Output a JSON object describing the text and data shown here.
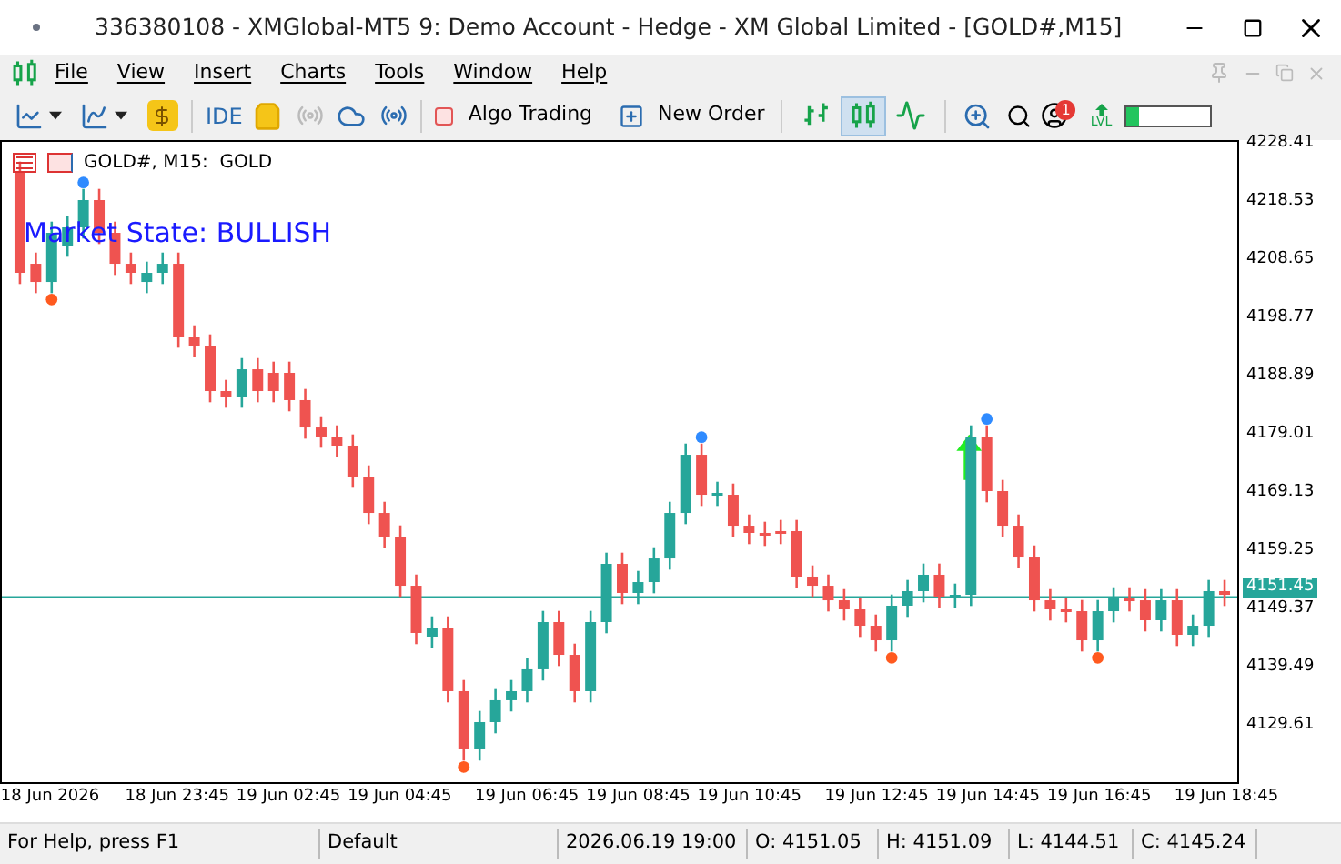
{
  "window": {
    "title": "336380108 - XMGlobal-MT5 9: Demo Account - Hedge - XM Global Limited - [GOLD#,M15]"
  },
  "menu": [
    "File",
    "View",
    "Insert",
    "Charts",
    "Tools",
    "Window",
    "Help"
  ],
  "toolbar": {
    "ide": "IDE",
    "algo_trading": "Algo Trading",
    "new_order": "New Order",
    "chart_types": [
      {
        "selected": false
      },
      {
        "selected": true
      },
      {
        "selected": false
      }
    ],
    "notifications": "1",
    "level_label": "LVL",
    "signal_meter": {
      "level": 0.15
    }
  },
  "chart": {
    "header": "GOLD#, M15:  GOLD",
    "market_state": "Market State: BULLISH",
    "chart_data": {
      "type": "candlestick",
      "ylim": [
        4120.04,
        4228.72
      ],
      "yticks": [
        {
          "value": 4228.41,
          "label": "4228.41"
        },
        {
          "value": 4218.53,
          "label": "4218.53"
        },
        {
          "value": 4208.65,
          "label": "4208.65"
        },
        {
          "value": 4198.77,
          "label": "4198.77"
        },
        {
          "value": 4188.89,
          "label": "4188.89"
        },
        {
          "value": 4179.01,
          "label": "4179.01"
        },
        {
          "value": 4169.13,
          "label": "4169.13"
        },
        {
          "value": 4159.25,
          "label": "4159.25"
        },
        {
          "value": 4149.37,
          "label": "4149.37"
        },
        {
          "value": 4139.49,
          "label": "4139.49"
        },
        {
          "value": 4129.61,
          "label": "4129.61"
        }
      ],
      "ref_lines": [
        {
          "axis": "y",
          "value": 4151.45,
          "label": "4151.45"
        }
      ],
      "categories": [
        null,
        null,
        "18 Jun 2026",
        null,
        null,
        null,
        null,
        null,
        null,
        null,
        "18 Jun 23:45",
        null,
        null,
        null,
        null,
        null,
        null,
        "19 Jun 02:45",
        null,
        null,
        null,
        null,
        null,
        null,
        "19 Jun 04:45",
        null,
        null,
        null,
        null,
        null,
        null,
        null,
        "19 Jun 06:45",
        null,
        null,
        null,
        null,
        null,
        null,
        "19 Jun 08:45",
        null,
        null,
        null,
        null,
        null,
        null,
        "19 Jun 10:45",
        null,
        null,
        null,
        null,
        null,
        null,
        null,
        "19 Jun 12:45",
        null,
        null,
        null,
        null,
        null,
        null,
        "19 Jun 14:45",
        null,
        null,
        null,
        null,
        null,
        null,
        "19 Jun 16:45",
        null,
        null,
        null,
        null,
        null,
        null,
        null,
        "19 Jun 18:45"
      ],
      "ohlc": [
        [
          4223.47,
          4225.37,
          4204.59,
          4206.49
        ],
        [
          4208.03,
          4209.93,
          4203.04,
          4204.94
        ],
        [
          4204.94,
          4215.18,
          4203.04,
          4213.28
        ],
        [
          4211.12,
          4216.11,
          4209.22,
          4214.21
        ],
        [
          4214.21,
          4220.74,
          4212.31,
          4218.84
        ],
        [
          4218.84,
          4220.74,
          4211.38,
          4213.28
        ],
        [
          4213.28,
          4215.18,
          4206.13,
          4208.03
        ],
        [
          4208.03,
          4209.93,
          4204.59,
          4206.49
        ],
        [
          4204.94,
          4208.39,
          4203.04,
          4206.49
        ],
        [
          4206.49,
          4209.93,
          4204.59,
          4208.03
        ],
        [
          4208.03,
          4209.93,
          4193.78,
          4195.68
        ],
        [
          4195.68,
          4197.58,
          4192.24,
          4194.14
        ],
        [
          4194.14,
          4196.04,
          4184.52,
          4186.42
        ],
        [
          4186.42,
          4188.32,
          4183.59,
          4185.49
        ],
        [
          4185.49,
          4192.02,
          4183.59,
          4190.12
        ],
        [
          4190.12,
          4192.02,
          4184.52,
          4186.42
        ],
        [
          4189.51,
          4191.41,
          4184.52,
          4186.42
        ],
        [
          4189.51,
          4191.41,
          4182.98,
          4184.88
        ],
        [
          4184.88,
          4186.78,
          4178.34,
          4180.24
        ],
        [
          4180.24,
          4182.14,
          4176.8,
          4178.7
        ],
        [
          4178.7,
          4180.6,
          4175.26,
          4177.16
        ],
        [
          4177.16,
          4179.06,
          4170.01,
          4171.91
        ],
        [
          4171.91,
          4173.81,
          4163.83,
          4165.73
        ],
        [
          4165.73,
          4167.63,
          4159.82,
          4161.72
        ],
        [
          4161.72,
          4163.62,
          4151.48,
          4153.38
        ],
        [
          4153.38,
          4155.28,
          4143.46,
          4145.36
        ],
        [
          4144.74,
          4148.18,
          4142.84,
          4146.28
        ],
        [
          4146.28,
          4148.18,
          4133.58,
          4135.48
        ],
        [
          4135.48,
          4137.38,
          4123.7,
          4125.6
        ],
        [
          4125.6,
          4132.13,
          4123.7,
          4130.23
        ],
        [
          4130.23,
          4135.84,
          4128.33,
          4133.94
        ],
        [
          4133.94,
          4137.38,
          4132.04,
          4135.48
        ],
        [
          4135.48,
          4141.09,
          4133.58,
          4139.19
        ],
        [
          4139.19,
          4149.11,
          4137.29,
          4147.21
        ],
        [
          4147.21,
          4149.11,
          4139.75,
          4141.65
        ],
        [
          4141.65,
          4143.55,
          4133.58,
          4135.48
        ],
        [
          4135.48,
          4149.11,
          4133.58,
          4147.21
        ],
        [
          4147.21,
          4158.99,
          4145.31,
          4157.09
        ],
        [
          4157.09,
          4158.99,
          4150.25,
          4152.15
        ],
        [
          4152.15,
          4155.9,
          4150.25,
          4154.0
        ],
        [
          4154.0,
          4159.91,
          4152.1,
          4158.01
        ],
        [
          4158.01,
          4167.63,
          4156.11,
          4165.73
        ],
        [
          4165.73,
          4177.51,
          4163.83,
          4175.61
        ],
        [
          4175.61,
          4177.51,
          4166.92,
          4168.82
        ],
        [
          4168.82,
          4171.03,
          4166.92,
          4169.13
        ],
        [
          4168.82,
          4170.72,
          4161.67,
          4163.57
        ],
        [
          4163.57,
          4165.47,
          4160.44,
          4162.34
        ],
        [
          4162.34,
          4164.24,
          4160.13,
          4162.03
        ],
        [
          4162.65,
          4164.55,
          4160.44,
          4162.34
        ],
        [
          4162.65,
          4164.55,
          4153.03,
          4154.93
        ],
        [
          4154.93,
          4156.83,
          4151.48,
          4153.38
        ],
        [
          4153.38,
          4155.28,
          4149.01,
          4150.91
        ],
        [
          4150.91,
          4152.81,
          4147.47,
          4149.37
        ],
        [
          4149.37,
          4151.27,
          4144.69,
          4146.59
        ],
        [
          4146.59,
          4148.49,
          4142.22,
          4144.12
        ],
        [
          4144.12,
          4151.89,
          4142.22,
          4149.99
        ],
        [
          4149.99,
          4154.36,
          4148.09,
          4152.46
        ],
        [
          4152.46,
          4157.14,
          4150.56,
          4155.24
        ],
        [
          4155.24,
          4157.14,
          4149.63,
          4151.53
        ],
        [
          4151.53,
          4153.74,
          4149.63,
          4151.84
        ],
        [
          4151.84,
          4180.6,
          4149.94,
          4178.7
        ],
        [
          4178.7,
          4180.6,
          4167.54,
          4169.44
        ],
        [
          4169.44,
          4171.34,
          4161.67,
          4163.57
        ],
        [
          4163.57,
          4165.47,
          4156.42,
          4158.32
        ],
        [
          4158.32,
          4160.22,
          4149.01,
          4150.91
        ],
        [
          4150.91,
          4152.81,
          4147.47,
          4149.37
        ],
        [
          4149.37,
          4151.27,
          4147.16,
          4149.06
        ],
        [
          4149.06,
          4150.96,
          4142.22,
          4144.12
        ],
        [
          4144.12,
          4150.96,
          4142.22,
          4149.06
        ],
        [
          4149.06,
          4153.12,
          4147.16,
          4151.22
        ],
        [
          4151.22,
          4153.12,
          4149.01,
          4150.91
        ],
        [
          4150.91,
          4152.81,
          4145.62,
          4147.52
        ],
        [
          4147.52,
          4152.81,
          4145.62,
          4150.91
        ],
        [
          4150.91,
          4152.81,
          4143.15,
          4145.05
        ],
        [
          4145.05,
          4148.49,
          4143.15,
          4146.59
        ],
        [
          4146.59,
          4154.36,
          4144.69,
          4152.46
        ],
        [
          4152.46,
          4154.36,
          4149.94,
          4151.84
        ]
      ]
    }
  },
  "status_bar": [
    "For Help, press F1",
    "Default",
    "2026.06.19 19:00",
    "O: 4151.05",
    "H: 4151.09",
    "L: 4144.51",
    "C: 4145.24"
  ]
}
